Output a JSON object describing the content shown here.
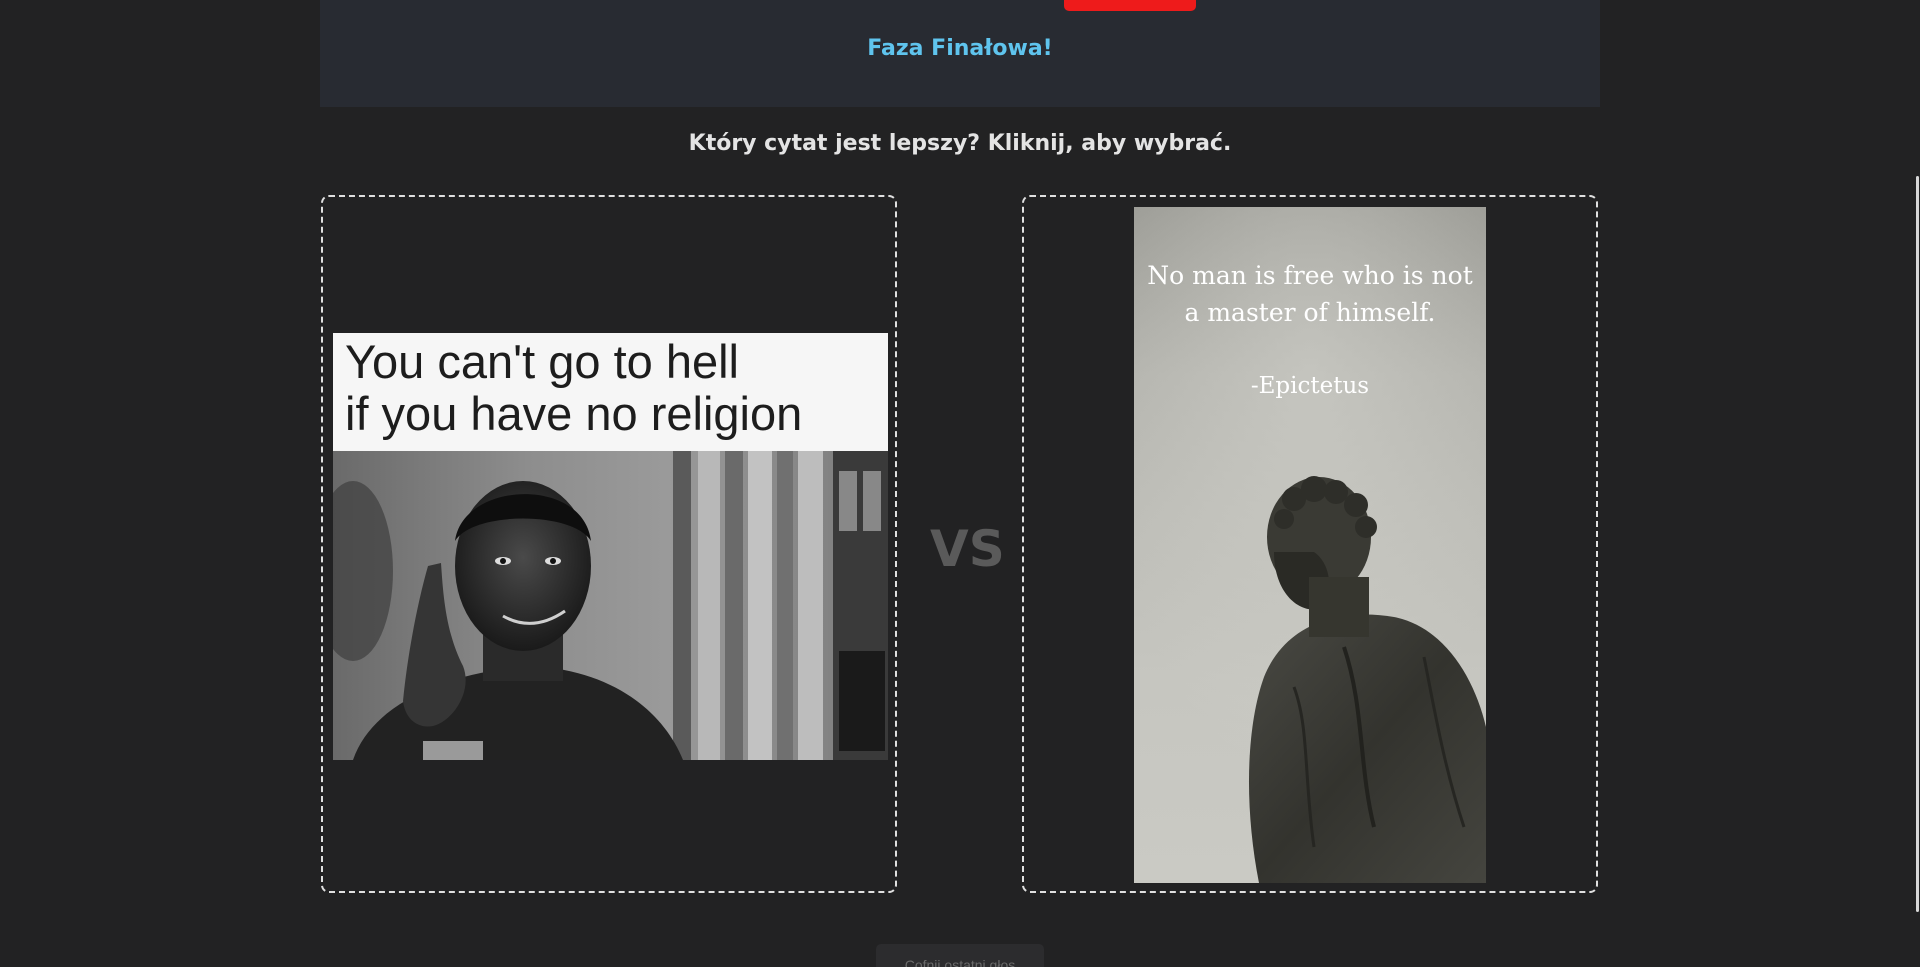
{
  "header": {
    "link_text": "",
    "red_button_label": "",
    "phase_title": "Faza Finałowa!"
  },
  "question": "Który cytat jest lepszy? Kliknij, aby wybrać.",
  "vs_label": "VS",
  "left_card": {
    "meme_caption": "You can't go to hell\nif you have no religion",
    "photo_description_icon": "man-pointing-temple-photo"
  },
  "right_card": {
    "quote": "No man is free who is not a master of himself.",
    "author": "-Epictetus",
    "photo_description_icon": "hercules-statue-photo"
  },
  "undo_button_label": "Cofnij ostatni głos",
  "colors": {
    "background": "#222223",
    "header_bg": "#282b32",
    "accent_blue": "#5fc4ee",
    "accent_red": "#ee1b1b"
  }
}
